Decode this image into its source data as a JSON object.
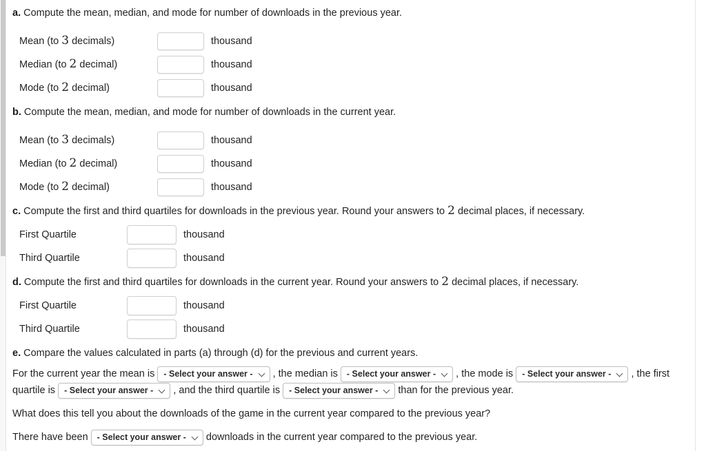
{
  "parts": {
    "a": {
      "letter": "a.",
      "prompt": "Compute the mean, median, and mode for number of downloads in the previous year.",
      "rows": [
        {
          "label_pre": "Mean (to ",
          "num": "3",
          "label_post": " decimals)",
          "unit": "thousand",
          "value": ""
        },
        {
          "label_pre": "Median (to ",
          "num": "2",
          "label_post": " decimal)",
          "unit": "thousand",
          "value": ""
        },
        {
          "label_pre": "Mode (to ",
          "num": "2",
          "label_post": " decimal)",
          "unit": "thousand",
          "value": ""
        }
      ]
    },
    "b": {
      "letter": "b.",
      "prompt": "Compute the mean, median, and mode for number of downloads in the current year.",
      "rows": [
        {
          "label_pre": "Mean (to ",
          "num": "3",
          "label_post": " decimals)",
          "unit": "thousand",
          "value": ""
        },
        {
          "label_pre": "Median (to ",
          "num": "2",
          "label_post": " decimal)",
          "unit": "thousand",
          "value": ""
        },
        {
          "label_pre": "Mode (to ",
          "num": "2",
          "label_post": " decimal)",
          "unit": "thousand",
          "value": ""
        }
      ]
    },
    "c": {
      "letter": "c.",
      "prompt_pre": "Compute the first and third quartiles for downloads in the previous year. Round your answers to ",
      "num": "2",
      "prompt_post": " decimal places, if necessary.",
      "rows": [
        {
          "label": "First Quartile",
          "unit": "thousand",
          "value": ""
        },
        {
          "label": "Third Quartile",
          "unit": "thousand",
          "value": ""
        }
      ]
    },
    "d": {
      "letter": "d.",
      "prompt_pre": "Compute the first and third quartiles for downloads in the current year. Round your answers to ",
      "num": "2",
      "prompt_post": " decimal places, if necessary.",
      "rows": [
        {
          "label": "First Quartile",
          "unit": "thousand",
          "value": ""
        },
        {
          "label": "Third Quartile",
          "unit": "thousand",
          "value": ""
        }
      ]
    },
    "e": {
      "letter": "e.",
      "prompt": "Compare the values calculated in parts (a) through (d) for the previous and current years.",
      "sentence": {
        "t1": "For the current year the mean is ",
        "t2": " , the median is ",
        "t3": " , the mode is ",
        "t4": " , the first quartile is ",
        "t5": " , and the third quartile is ",
        "t6": " than for the previous year."
      },
      "followup_question": "What does this tell you about the downloads of the game in the current year compared to the previous year?",
      "followup_sentence": {
        "t1": "There have been ",
        "t2": " downloads in the current year compared to the previous year."
      },
      "select_placeholder": "- Select your answer -"
    }
  },
  "colors": {
    "text": "#242424",
    "border": "#cfcfcf",
    "select_border": "#bdbdbd",
    "scrollbar_thumb": "#c9c9c9",
    "scrollbar_track": "#f7f7f7"
  }
}
